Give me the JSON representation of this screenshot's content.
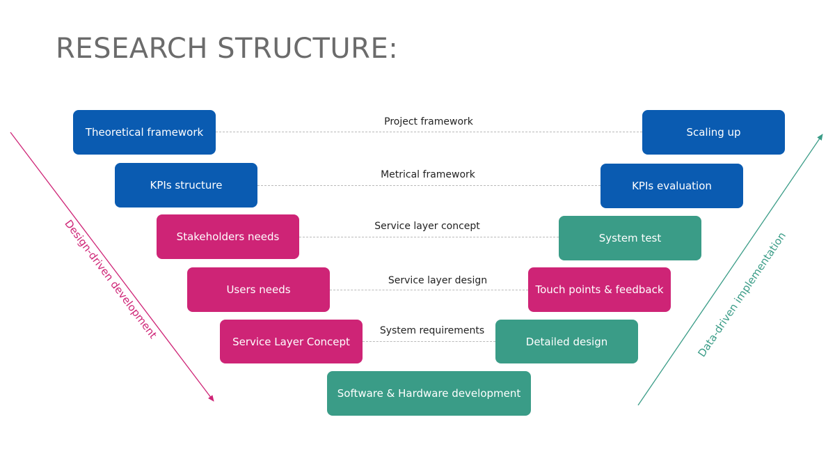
{
  "title": "RESEARCH STRUCTURE:",
  "colors": {
    "blue": "#0a5bb1",
    "pink": "#ce2476",
    "green": "#3a9c87",
    "title_gray": "#6b6b6b",
    "connector_gray": "#b9b9b9"
  },
  "left_axis": {
    "label": "Design-driven development",
    "direction": "down",
    "color": "#ce2476"
  },
  "right_axis": {
    "label": "Data-driven implementation",
    "direction": "up",
    "color": "#3a9c87"
  },
  "rows": [
    {
      "left": "Theoretical framework",
      "left_color": "blue",
      "link": "Project framework",
      "right": "Scaling up",
      "right_color": "blue"
    },
    {
      "left": "KPIs structure",
      "left_color": "blue",
      "link": "Metrical framework",
      "right": "KPIs evaluation",
      "right_color": "blue"
    },
    {
      "left": "Stakeholders needs",
      "left_color": "pink",
      "link": "Service layer concept",
      "right": "System test",
      "right_color": "green"
    },
    {
      "left": "Users needs",
      "left_color": "pink",
      "link": "Service layer design",
      "right": "Touch points & feedback",
      "right_color": "pink"
    },
    {
      "left": "Service Layer Concept",
      "left_color": "pink",
      "link": "System requirements",
      "right": "Detailed design",
      "right_color": "green"
    }
  ],
  "bottom": {
    "label": "Software & Hardware development",
    "color": "green"
  }
}
